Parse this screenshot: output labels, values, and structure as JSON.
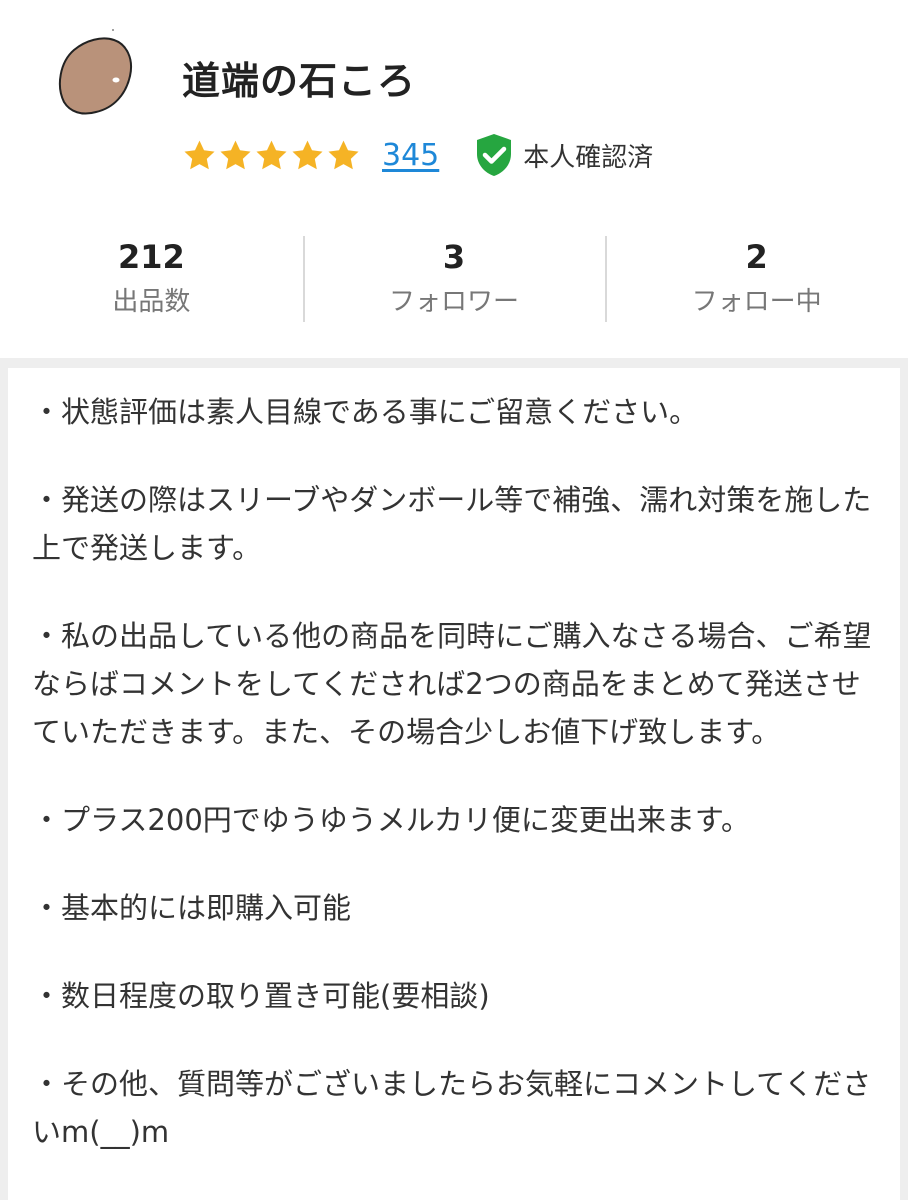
{
  "profile": {
    "username": "道端の石ころ",
    "avatar_icon": "stone-avatar-icon",
    "rating": {
      "stars": 5,
      "star_color": "#f5b325"
    },
    "review_count": "345",
    "verified": {
      "label": "本人確認済",
      "icon": "check-shield-icon",
      "color": "#26a640"
    }
  },
  "stats": [
    {
      "value": "212",
      "label": "出品数"
    },
    {
      "value": "3",
      "label": "フォロワー"
    },
    {
      "value": "2",
      "label": "フォロー中"
    }
  ],
  "bio": [
    "・状態評価は素人目線である事にご留意ください。",
    "・発送の際はスリーブやダンボール等で補強、濡れ対策を施した上で発送します。",
    "・私の出品している他の商品を同時にご購入なさる場合、ご希望ならばコメントをしてくだされば2つの商品をまとめて発送させていただきます。また、その場合少しお値下げ致します。",
    "・プラス200円でゆうゆうメルカリ便に変更出来ます。",
    "・基本的には即購入可能",
    "・数日程度の取り置き可能(要相談)",
    "・その他、質問等がございましたらお気軽にコメントしてくださいm(__)m"
  ],
  "colors": {
    "link": "#1e88d8",
    "background_band": "#eeeeee",
    "divider": "#d9d9d9"
  }
}
